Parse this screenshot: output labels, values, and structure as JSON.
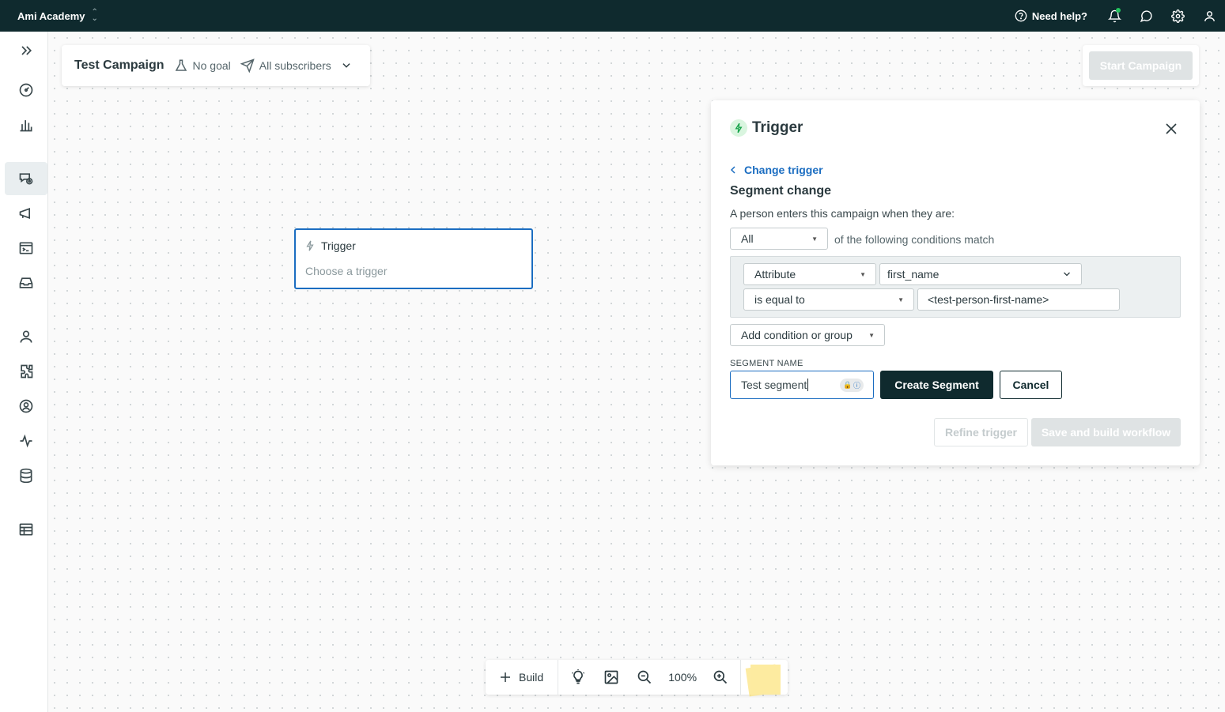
{
  "topbar": {
    "workspace": "Ami Academy",
    "help": "Need help?",
    "icons": [
      "help-circle-icon",
      "bell-icon",
      "chat-icon",
      "gear-icon",
      "user-icon"
    ]
  },
  "sidebar": {
    "items": [
      "expand-icon",
      "dashboard-icon",
      "analytics-icon",
      "campaigns-icon",
      "broadcasts-icon",
      "transactional-icon",
      "inbox-icon",
      "people-icon",
      "integrations-icon",
      "segments-icon",
      "activity-icon",
      "data-icon",
      "reports-icon"
    ]
  },
  "campaign": {
    "title": "Test Campaign",
    "goal": "No goal",
    "audience": "All subscribers",
    "start_label": "Start Campaign"
  },
  "trigger_node": {
    "title": "Trigger",
    "subtitle": "Choose a trigger"
  },
  "toolbar": {
    "build_label": "Build",
    "zoom": "100%"
  },
  "panel": {
    "title": "Trigger",
    "change_trigger": "Change trigger",
    "segment_title": "Segment change",
    "description": "A person enters this campaign when they are:",
    "match_select": "All",
    "match_text": "of the following conditions match",
    "condition": {
      "type": "Attribute",
      "attribute": "first_name",
      "operator": "is equal to",
      "value": "<test-person-first-name>"
    },
    "add_condition": "Add condition or group",
    "segment_name_label": "SEGMENT NAME",
    "segment_name_value": "Test segment",
    "create_segment": "Create Segment",
    "cancel": "Cancel",
    "refine_trigger": "Refine trigger",
    "save_build": "Save and build workflow"
  },
  "colors": {
    "topbar_bg": "#0f2a2e",
    "accent_blue": "#1b6dc1",
    "status_green": "#22c55e"
  }
}
